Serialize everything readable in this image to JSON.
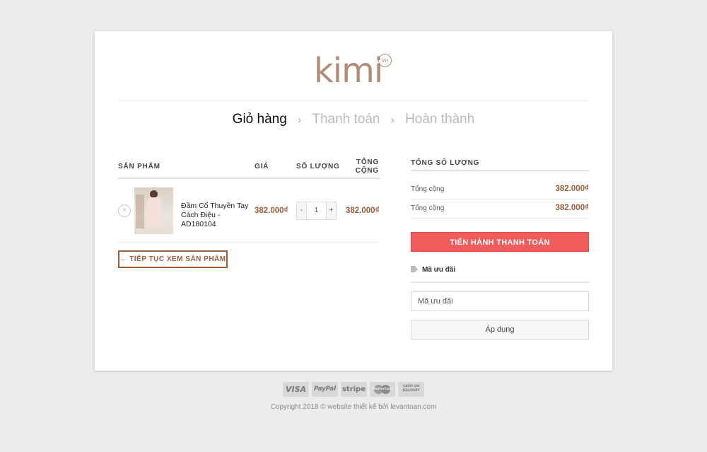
{
  "brand": {
    "logo_text": "kimi",
    "logo_badge": "vn",
    "accent_color": "#b28a78"
  },
  "steps": [
    {
      "label": "Giỏ hàng",
      "active": true
    },
    {
      "label": "Thanh toán",
      "active": false
    },
    {
      "label": "Hoàn thành",
      "active": false
    }
  ],
  "cart": {
    "headers": {
      "product": "SẢN PHẨM",
      "price": "GIÁ",
      "quantity": "SỐ LƯỢNG",
      "total_line1": "TỔNG",
      "total_line2": "CỘNG"
    },
    "items": [
      {
        "name": "Đầm Cổ Thuyền Tay Cách Điệu - AD180104",
        "price": "382.000₫",
        "quantity": "1",
        "minus": "-",
        "plus": "+",
        "subtotal": "382.000₫",
        "remove_icon": "×"
      }
    ],
    "continue_label": "← TIẾP TỤC XEM SẢN PHẨM"
  },
  "summary": {
    "title": "TỔNG SỐ LƯỢNG",
    "rows": [
      {
        "label": "Tổng cộng",
        "value": "382.000₫"
      },
      {
        "label": "Tổng cộng",
        "value": "382.000₫"
      }
    ],
    "checkout_label": "TIẾN HÀNH THANH TOÁN",
    "checkout_color": "#f05b5b",
    "coupon_label": "Mã ưu đãi",
    "coupon_placeholder": "Mã ưu đãi",
    "apply_label": "Áp dụng"
  },
  "footer": {
    "payments": {
      "visa": "VISA",
      "paypal": "PayPal",
      "stripe": "stripe",
      "mastercard": "MasterCard",
      "cod": "CASH ON DELIVERY"
    },
    "copyright": "Copyright 2018 © website thiết kế bởi levantoan.com"
  },
  "price_color": "#9b5d3a"
}
